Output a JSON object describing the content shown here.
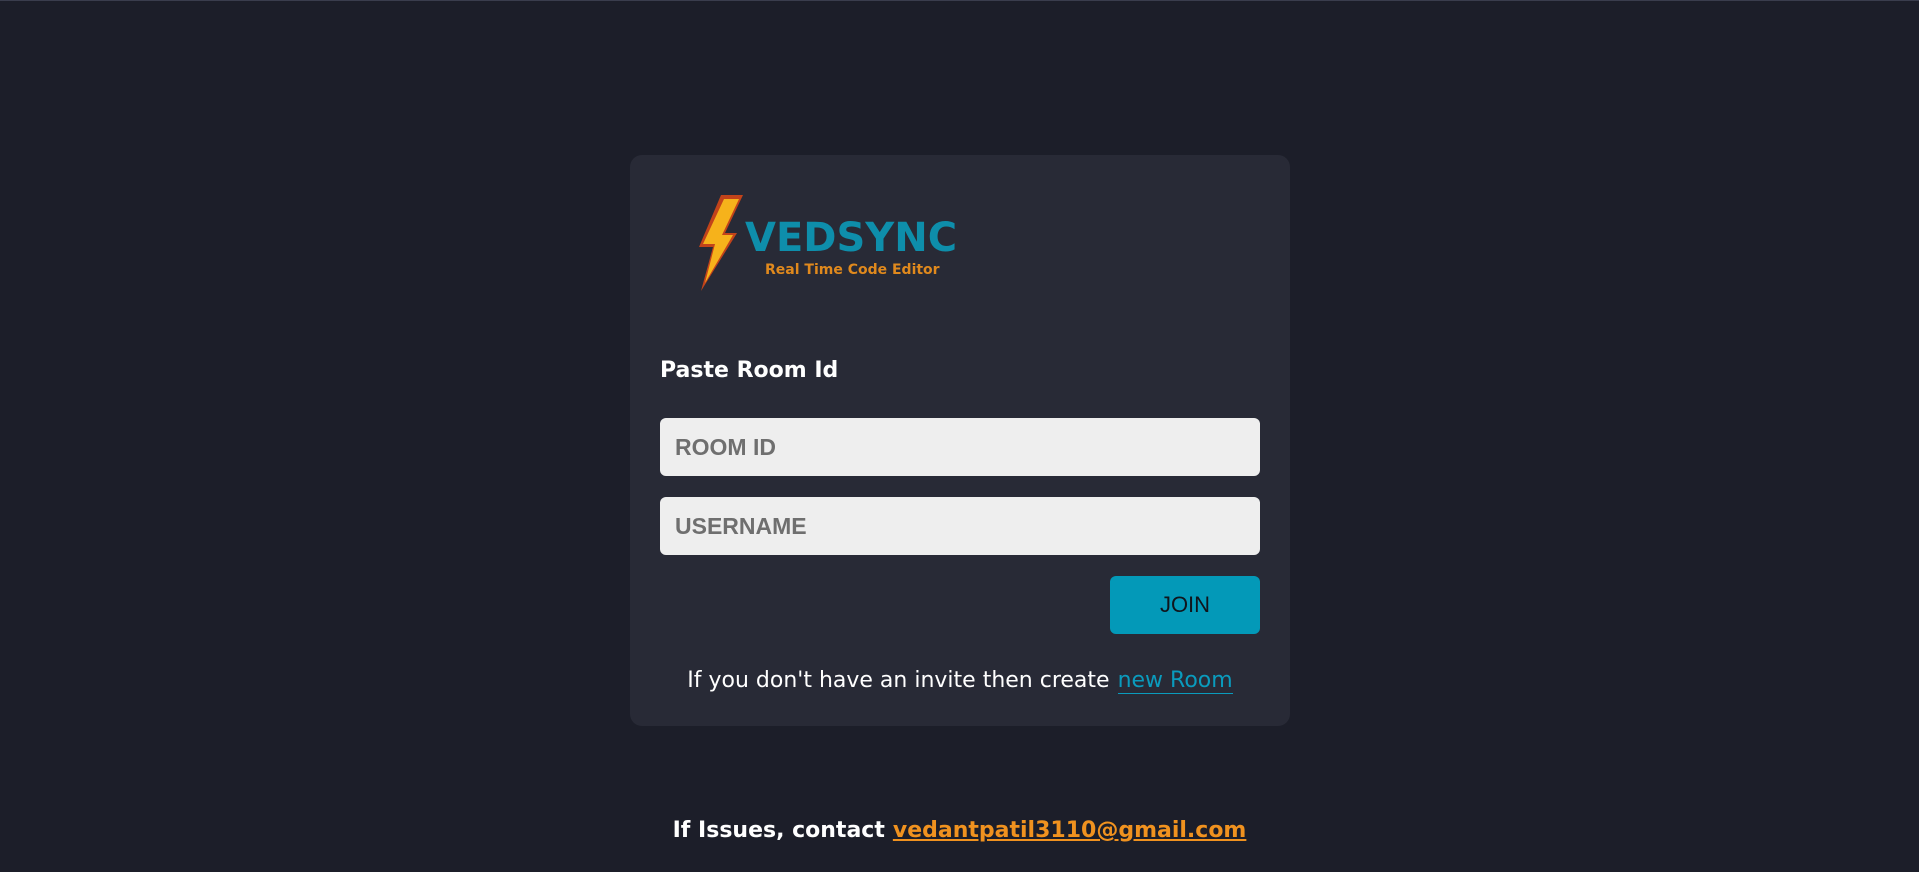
{
  "brand": {
    "name": "VEDSYNC",
    "tagline": "Real Time Code Editor",
    "icon": "lightning-bolt-icon",
    "colors": {
      "name": "#0e8eab",
      "tagline": "#e0891d",
      "bolt_fill": "#f6b21b",
      "bolt_stroke": "#c2431a"
    }
  },
  "form": {
    "label": "Paste Room Id",
    "room_id_placeholder": "ROOM ID",
    "room_id_value": "",
    "username_placeholder": "USERNAME",
    "username_value": "",
    "join_label": "JOIN"
  },
  "invite": {
    "text": "If you don't have an invite then create",
    "link_label": "new Room"
  },
  "footer": {
    "text": "If Issues, contact",
    "email": "vedantpatil3110@gmail.com"
  },
  "colors": {
    "background": "#1c1e29",
    "card": "#282a36",
    "accent": "#0399b8",
    "link": "#0a9bbd",
    "email": "#f0921f"
  }
}
